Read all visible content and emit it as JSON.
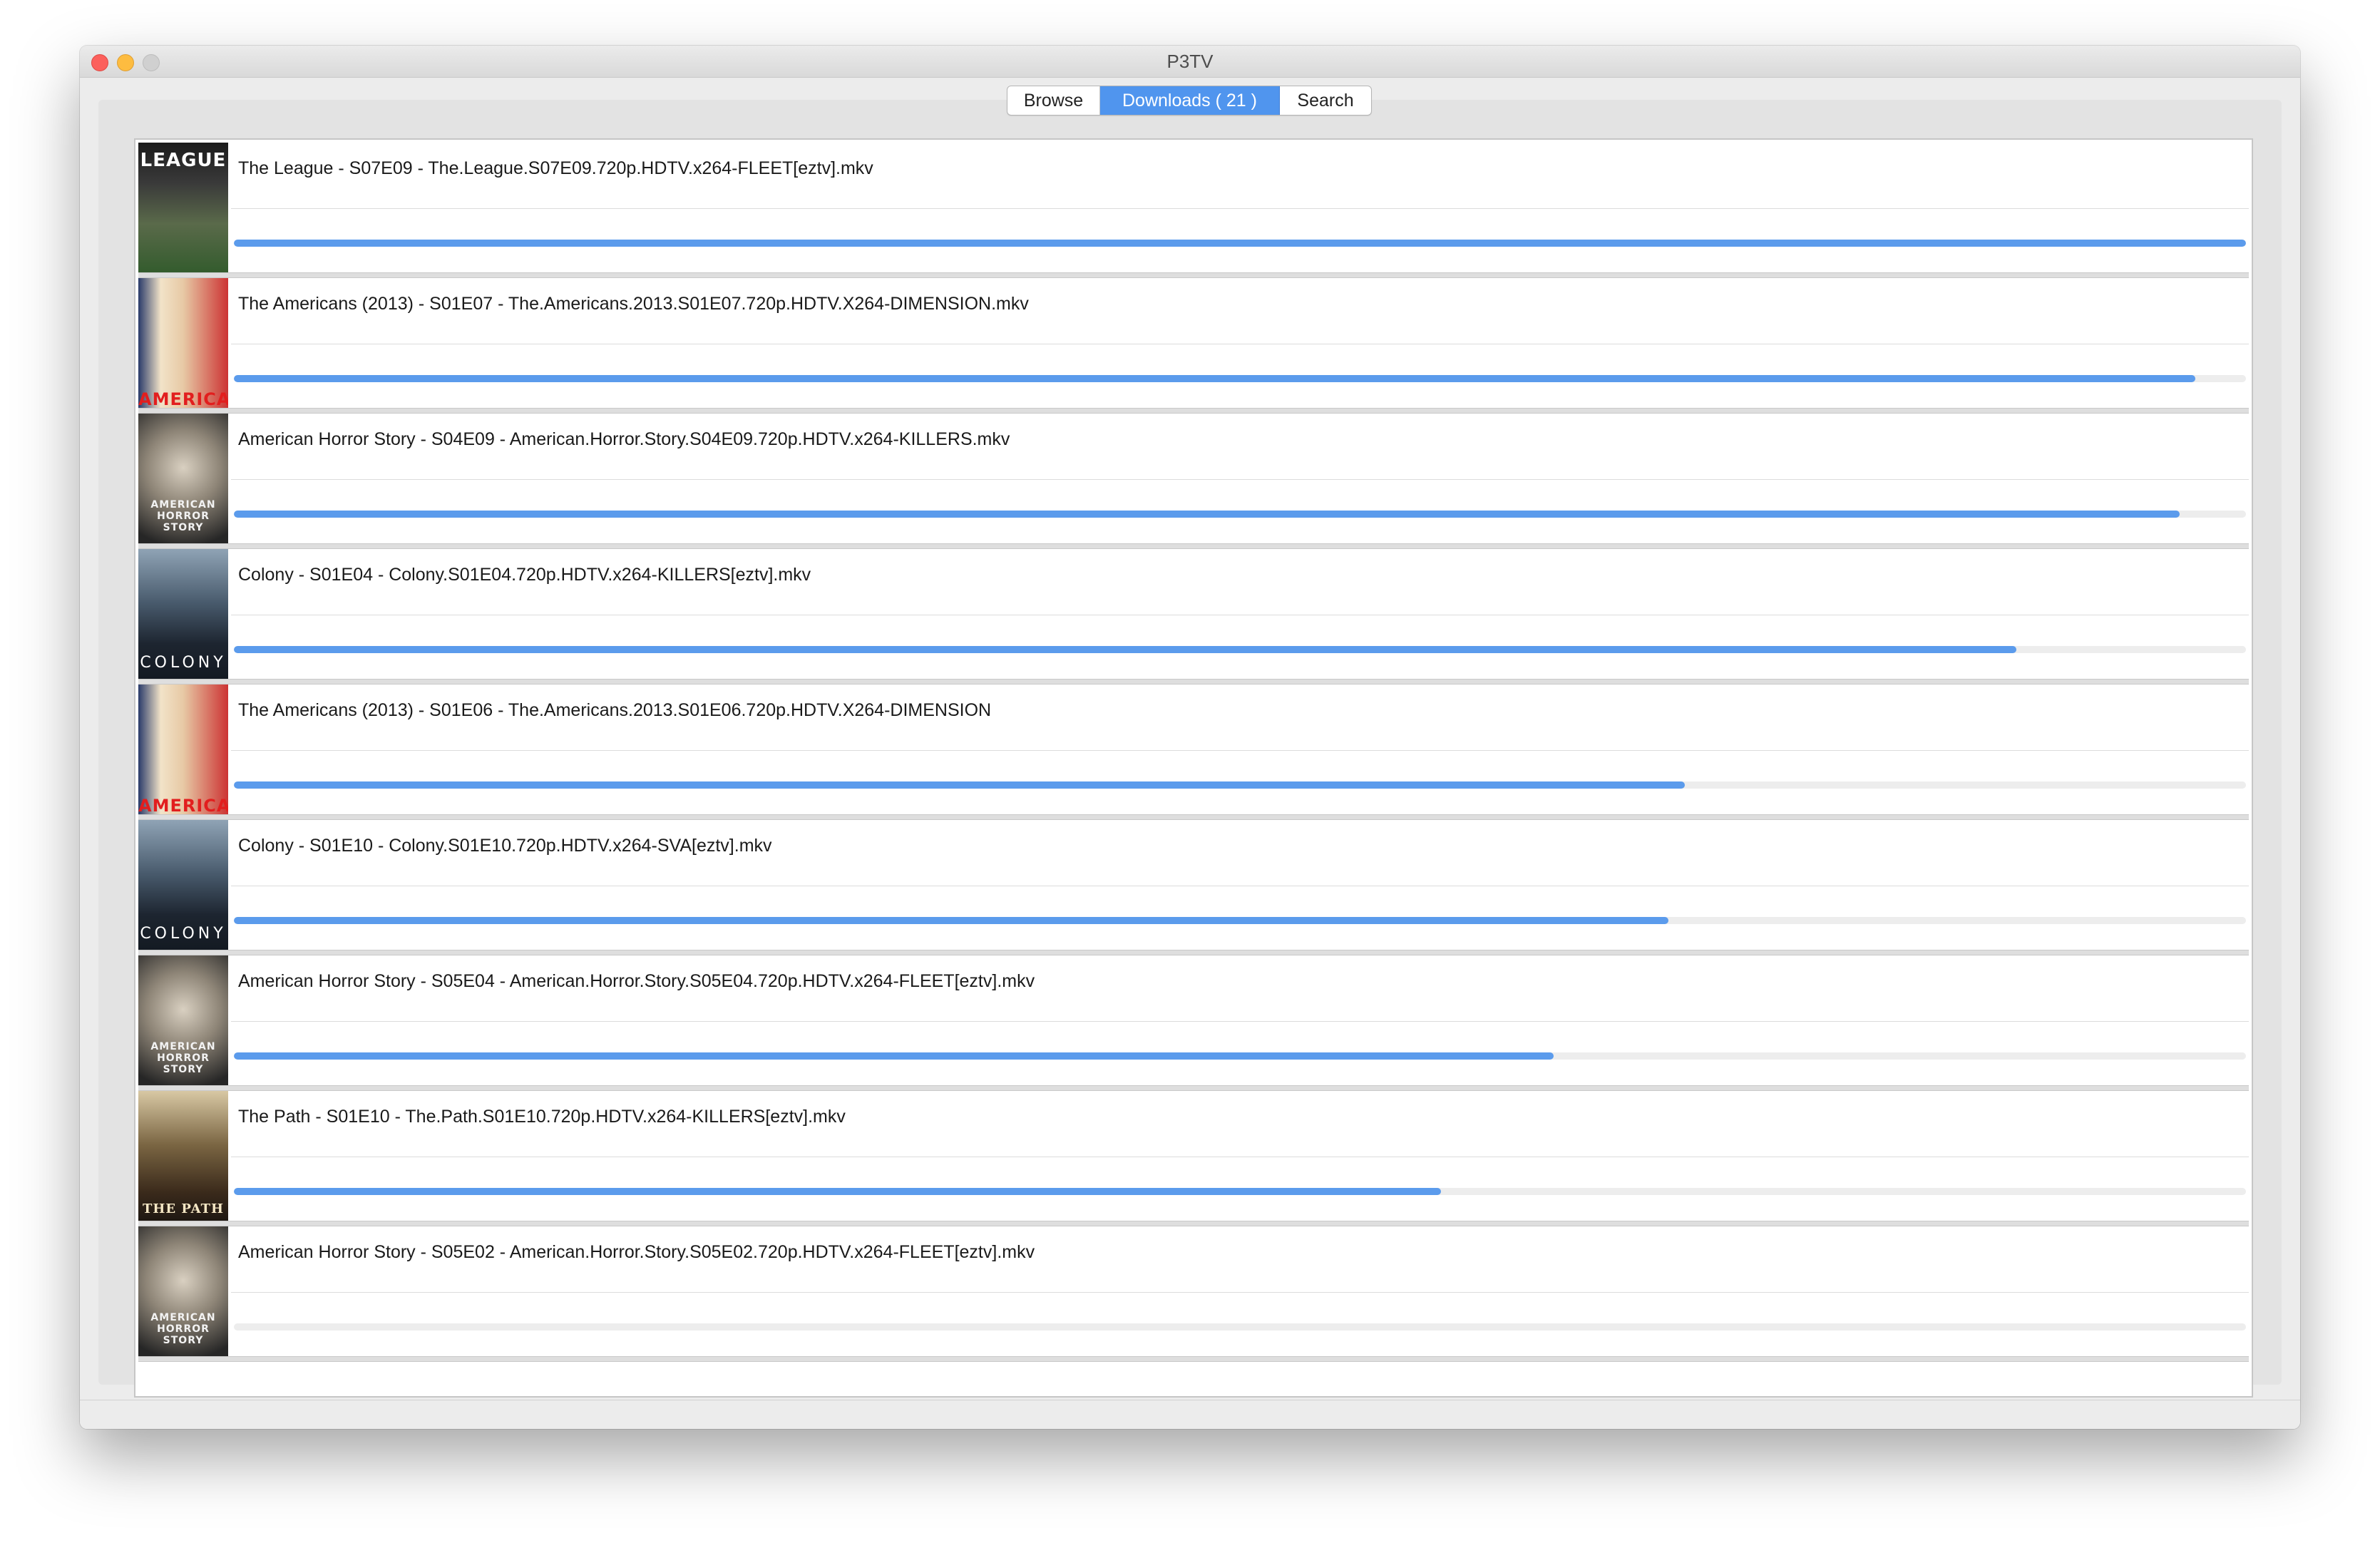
{
  "window": {
    "title": "P3TV"
  },
  "tabs": [
    {
      "label": "Browse",
      "selected": false
    },
    {
      "label": "Downloads ( 21 )",
      "selected": true
    },
    {
      "label": "Search",
      "selected": false
    }
  ],
  "colors": {
    "accent": "#5095ee",
    "progress": "#5b9bec",
    "close": "#fc605c",
    "minimize": "#fdbc40",
    "maximize": "#d0d0d0"
  },
  "downloads": [
    {
      "title": "The League - S07E09 - The.League.S07E09.720p.HDTV.x264-FLEET[eztv].mkv",
      "poster": "league",
      "poster_text": "LEAGUE",
      "progress": 1.0
    },
    {
      "title": "The Americans (2013) - S01E07 - The.Americans.2013.S01E07.720p.HDTV.X264-DIMENSION.mkv",
      "poster": "americans",
      "poster_text": "AMERICANS",
      "progress": 0.975
    },
    {
      "title": "American Horror Story - S04E09 - American.Horror.Story.S04E09.720p.HDTV.x264-KILLERS.mkv",
      "poster": "ahs",
      "poster_text": "AMERICAN HORROR STORY",
      "progress": 0.967
    },
    {
      "title": "Colony - S01E04 - Colony.S01E04.720p.HDTV.x264-KILLERS[eztv].mkv",
      "poster": "colony",
      "poster_text": "COLONY",
      "progress": 0.886
    },
    {
      "title": "The Americans (2013) - S01E06 - The.Americans.2013.S01E06.720p.HDTV.X264-DIMENSION",
      "poster": "americans",
      "poster_text": "AMERICANS",
      "progress": 0.721
    },
    {
      "title": "Colony - S01E10 - Colony.S01E10.720p.HDTV.x264-SVA[eztv].mkv",
      "poster": "colony",
      "poster_text": "COLONY",
      "progress": 0.713
    },
    {
      "title": "American Horror Story - S05E04 - American.Horror.Story.S05E04.720p.HDTV.x264-FLEET[eztv].mkv",
      "poster": "ahs",
      "poster_text": "AMERICAN HORROR STORY",
      "progress": 0.656
    },
    {
      "title": "The Path - S01E10 - The.Path.S01E10.720p.HDTV.x264-KILLERS[eztv].mkv",
      "poster": "path",
      "poster_text": "THE PATH",
      "progress": 0.6
    },
    {
      "title": "American Horror Story - S05E02 - American.Horror.Story.S05E02.720p.HDTV.x264-FLEET[eztv].mkv",
      "poster": "ahs",
      "poster_text": "AMERICAN HORROR STORY",
      "progress": 0.0
    }
  ]
}
